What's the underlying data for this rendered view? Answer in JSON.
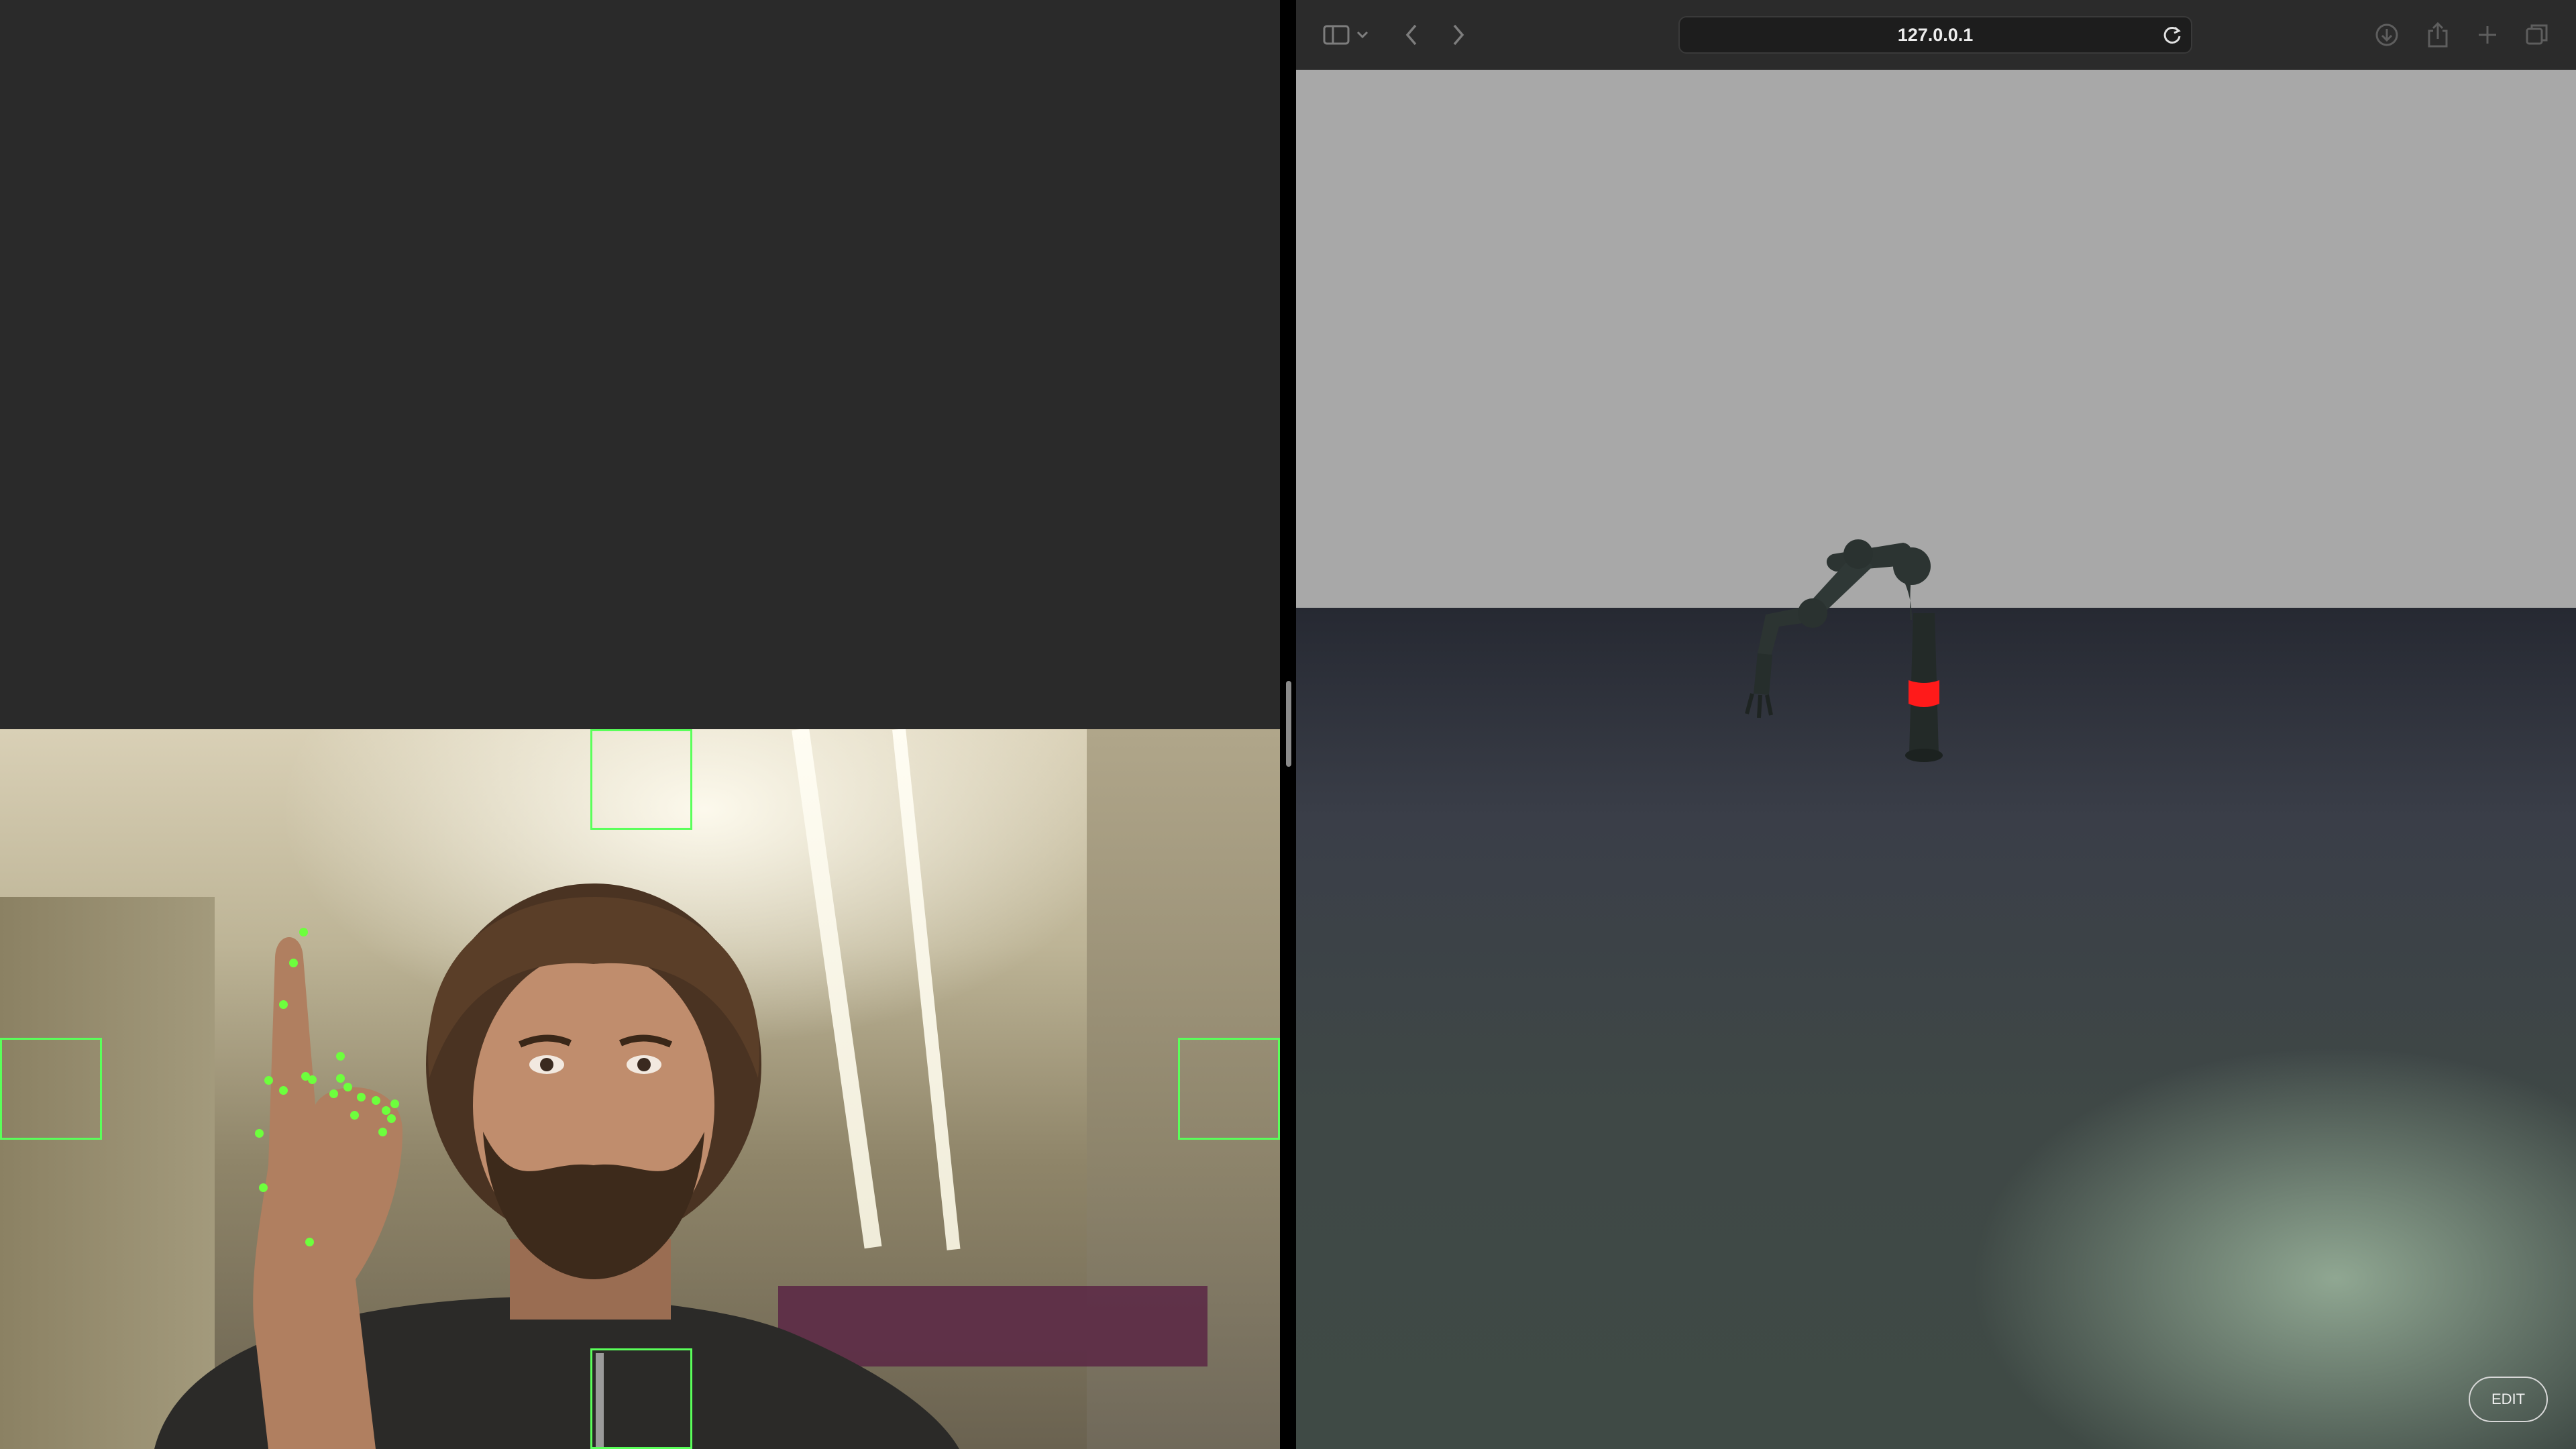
{
  "browser": {
    "address": "127.0.0.1",
    "edit_label": "EDIT"
  },
  "icons": {
    "sidebar": "sidebar-icon",
    "chevron": "chevron-down-icon",
    "back": "back-arrow-icon",
    "forward": "forward-arrow-icon",
    "reload": "reload-icon",
    "download": "download-icon",
    "share": "share-icon",
    "new_tab": "plus-icon",
    "tab_overview": "tab-overview-icon"
  },
  "colors": {
    "tracking_green": "#5aff5a",
    "landmark_green": "#6dff3d",
    "robot_joint_highlight": "#ff1a1a",
    "toolbar": "#2b2b2b",
    "empty_pane": "#2a2a2a"
  },
  "camera": {
    "tracking_boxes": [
      "top",
      "left",
      "right",
      "bottom"
    ],
    "hand_landmark_count": 21
  }
}
